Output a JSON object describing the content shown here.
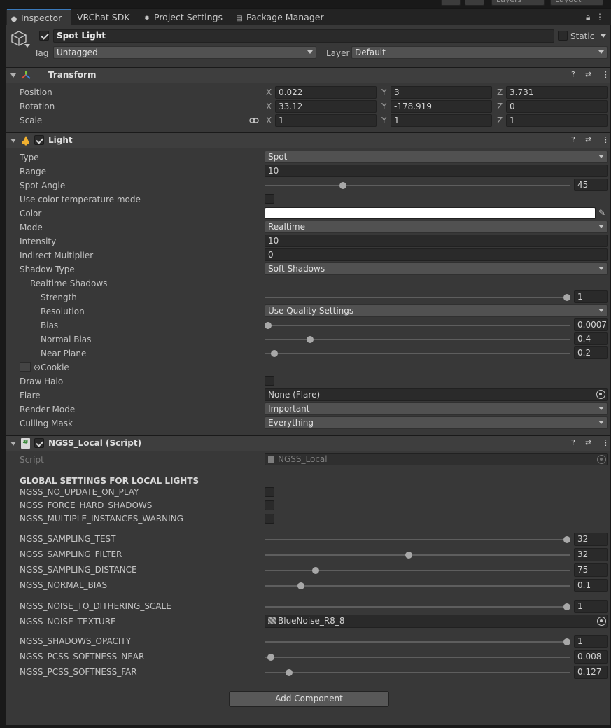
{
  "tabs": [
    {
      "label": "Inspector",
      "icon": "info-icon"
    },
    {
      "label": "VRChat SDK",
      "icon": ""
    },
    {
      "label": "Project Settings",
      "icon": "gear-icon"
    },
    {
      "label": "Package Manager",
      "icon": "package-icon"
    }
  ],
  "topbar": {
    "layers": "Layers",
    "layout": "Layout"
  },
  "object": {
    "name": "Spot Light",
    "active": true,
    "static_label": "Static",
    "tag_label": "Tag",
    "tag_value": "Untagged",
    "layer_label": "Layer",
    "layer_value": "Default"
  },
  "transform": {
    "title": "Transform",
    "position_label": "Position",
    "rotation_label": "Rotation",
    "scale_label": "Scale",
    "axis_x": "X",
    "axis_y": "Y",
    "axis_z": "Z",
    "position": [
      "0.022",
      "3",
      "3.731"
    ],
    "rotation": [
      "33.12",
      "-178.919",
      "0"
    ],
    "scale": [
      "1",
      "1",
      "1"
    ]
  },
  "light": {
    "title": "Light",
    "type_label": "Type",
    "type_value": "Spot",
    "range_label": "Range",
    "range_value": "10",
    "spot_angle_label": "Spot Angle",
    "spot_angle_value": "45",
    "spot_angle_fraction": 0.25,
    "color_temp_label": "Use color temperature mode",
    "color_label": "Color",
    "color_value": "#ffffff",
    "mode_label": "Mode",
    "mode_value": "Realtime",
    "intensity_label": "Intensity",
    "intensity_value": "10",
    "indirect_label": "Indirect Multiplier",
    "indirect_value": "0",
    "shadow_type_label": "Shadow Type",
    "shadow_type_value": "Soft Shadows",
    "realtime_shadows_label": "Realtime Shadows",
    "strength_label": "Strength",
    "strength_value": "1",
    "strength_fraction": 1.0,
    "resolution_label": "Resolution",
    "resolution_value": "Use Quality Settings",
    "bias_label": "Bias",
    "bias_value": "0.0007",
    "bias_fraction": 0.0,
    "normal_bias_label": "Normal Bias",
    "normal_bias_value": "0.4",
    "normal_bias_fraction": 0.14,
    "near_plane_label": "Near Plane",
    "near_plane_value": "0.2",
    "near_plane_fraction": 0.02,
    "cookie_label": "Cookie",
    "draw_halo_label": "Draw Halo",
    "flare_label": "Flare",
    "flare_value": "None (Flare)",
    "render_mode_label": "Render Mode",
    "render_mode_value": "Important",
    "culling_mask_label": "Culling Mask",
    "culling_mask_value": "Everything"
  },
  "ngss": {
    "title": "NGSS_Local (Script)",
    "script_label": "Script",
    "script_value": "NGSS_Local",
    "section_header": "GLOBAL SETTINGS FOR LOCAL LIGHTS",
    "toggles": [
      {
        "label": "NGSS_NO_UPDATE_ON_PLAY"
      },
      {
        "label": "NGSS_FORCE_HARD_SHADOWS"
      },
      {
        "label": "NGSS_MULTIPLE_INSTANCES_WARNING"
      }
    ],
    "sliders_a": [
      {
        "label": "NGSS_SAMPLING_TEST",
        "value": "32",
        "fraction": 1.0
      },
      {
        "label": "NGSS_SAMPLING_FILTER",
        "value": "32",
        "fraction": 0.47
      },
      {
        "label": "NGSS_SAMPLING_DISTANCE",
        "value": "75",
        "fraction": 0.16
      },
      {
        "label": "NGSS_NORMAL_BIAS",
        "value": "0.1",
        "fraction": 0.11
      }
    ],
    "noise_scale": {
      "label": "NGSS_NOISE_TO_DITHERING_SCALE",
      "value": "1",
      "fraction": 1.0
    },
    "noise_texture": {
      "label": "NGSS_NOISE_TEXTURE",
      "value": "BlueNoise_R8_8"
    },
    "sliders_b": [
      {
        "label": "NGSS_SHADOWS_OPACITY",
        "value": "1",
        "fraction": 1.0
      },
      {
        "label": "NGSS_PCSS_SOFTNESS_NEAR",
        "value": "0.008",
        "fraction": 0.01
      },
      {
        "label": "NGSS_PCSS_SOFTNESS_FAR",
        "value": "0.127",
        "fraction": 0.07
      }
    ]
  },
  "add_component": "Add Component"
}
